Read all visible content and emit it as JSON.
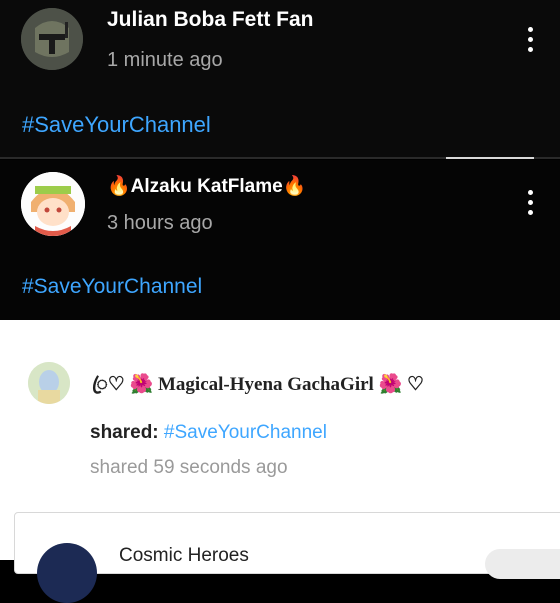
{
  "posts": [
    {
      "author": "Julian Boba Fett Fan",
      "time": "1 minute ago",
      "text": "#SaveYourChannel"
    },
    {
      "author": "🔥Alzaku KatFlame🔥",
      "time": "3 hours ago",
      "text": "#SaveYourChannel"
    }
  ],
  "shared_post": {
    "author": "ꦿ♡ 🌺 Magical-Hyena GachaGirl 🌺 ♡",
    "shared_prefix": "shared:",
    "shared_tag": "#SaveYourChannel",
    "time": "shared 59 seconds ago",
    "card_title": "Cosmic Heroes"
  },
  "colors": {
    "link": "#3ea6ff",
    "dark_bg": "#0a0a0a",
    "light_bg": "#ffffff"
  },
  "icons": {
    "menu": "more-vertical-icon"
  }
}
